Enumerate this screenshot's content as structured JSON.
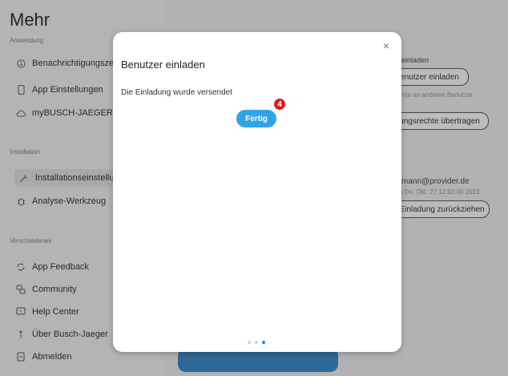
{
  "left": {
    "title": "Mehr",
    "sections": [
      {
        "header": "Anwendung",
        "items": [
          {
            "label": "Benachrichtigungszent",
            "icon": "bell-icon"
          },
          {
            "label": "App Einstellungen",
            "icon": "phone-icon"
          },
          {
            "label": "myBUSCH-JAEGER",
            "icon": "cloud-icon"
          }
        ]
      },
      {
        "header": "Installation",
        "items": [
          {
            "label": "Installationseinstellung",
            "icon": "wrench-icon"
          },
          {
            "label": "Analyse-Werkzeug",
            "icon": "bug-icon"
          }
        ]
      },
      {
        "header": "Verschiedenes",
        "items": [
          {
            "label": "App Feedback",
            "icon": "feedback-icon"
          },
          {
            "label": "Community",
            "icon": "community-icon"
          },
          {
            "label": "Help Center",
            "icon": "help-icon"
          },
          {
            "label": "Über Busch-Jaeger",
            "icon": "info-icon"
          },
          {
            "label": "Abmelden",
            "icon": "logout-icon"
          }
        ]
      }
    ]
  },
  "right": {
    "invite_text": "einladen",
    "invite_button": "enutzer einladen",
    "transfer_text": "chte an anderen Benutzer",
    "transfer_button": "ungsrechte übertragen",
    "email": "mann@provider.de",
    "date": "n Do. Okt. 27 12:03:00 2022",
    "revoke_button": "Einladung zurückziehen"
  },
  "modal": {
    "title": "Benutzer einladen",
    "message": "Die Einladung wurde versendet",
    "button": "Fertig",
    "close_symbol": "×",
    "step_badge": "4",
    "pages_total": 3,
    "page_active": 3
  },
  "colors": {
    "primary_button": "#2fa4e7",
    "badge": "#d81d1d",
    "active_dot": "#2a7fc1"
  }
}
